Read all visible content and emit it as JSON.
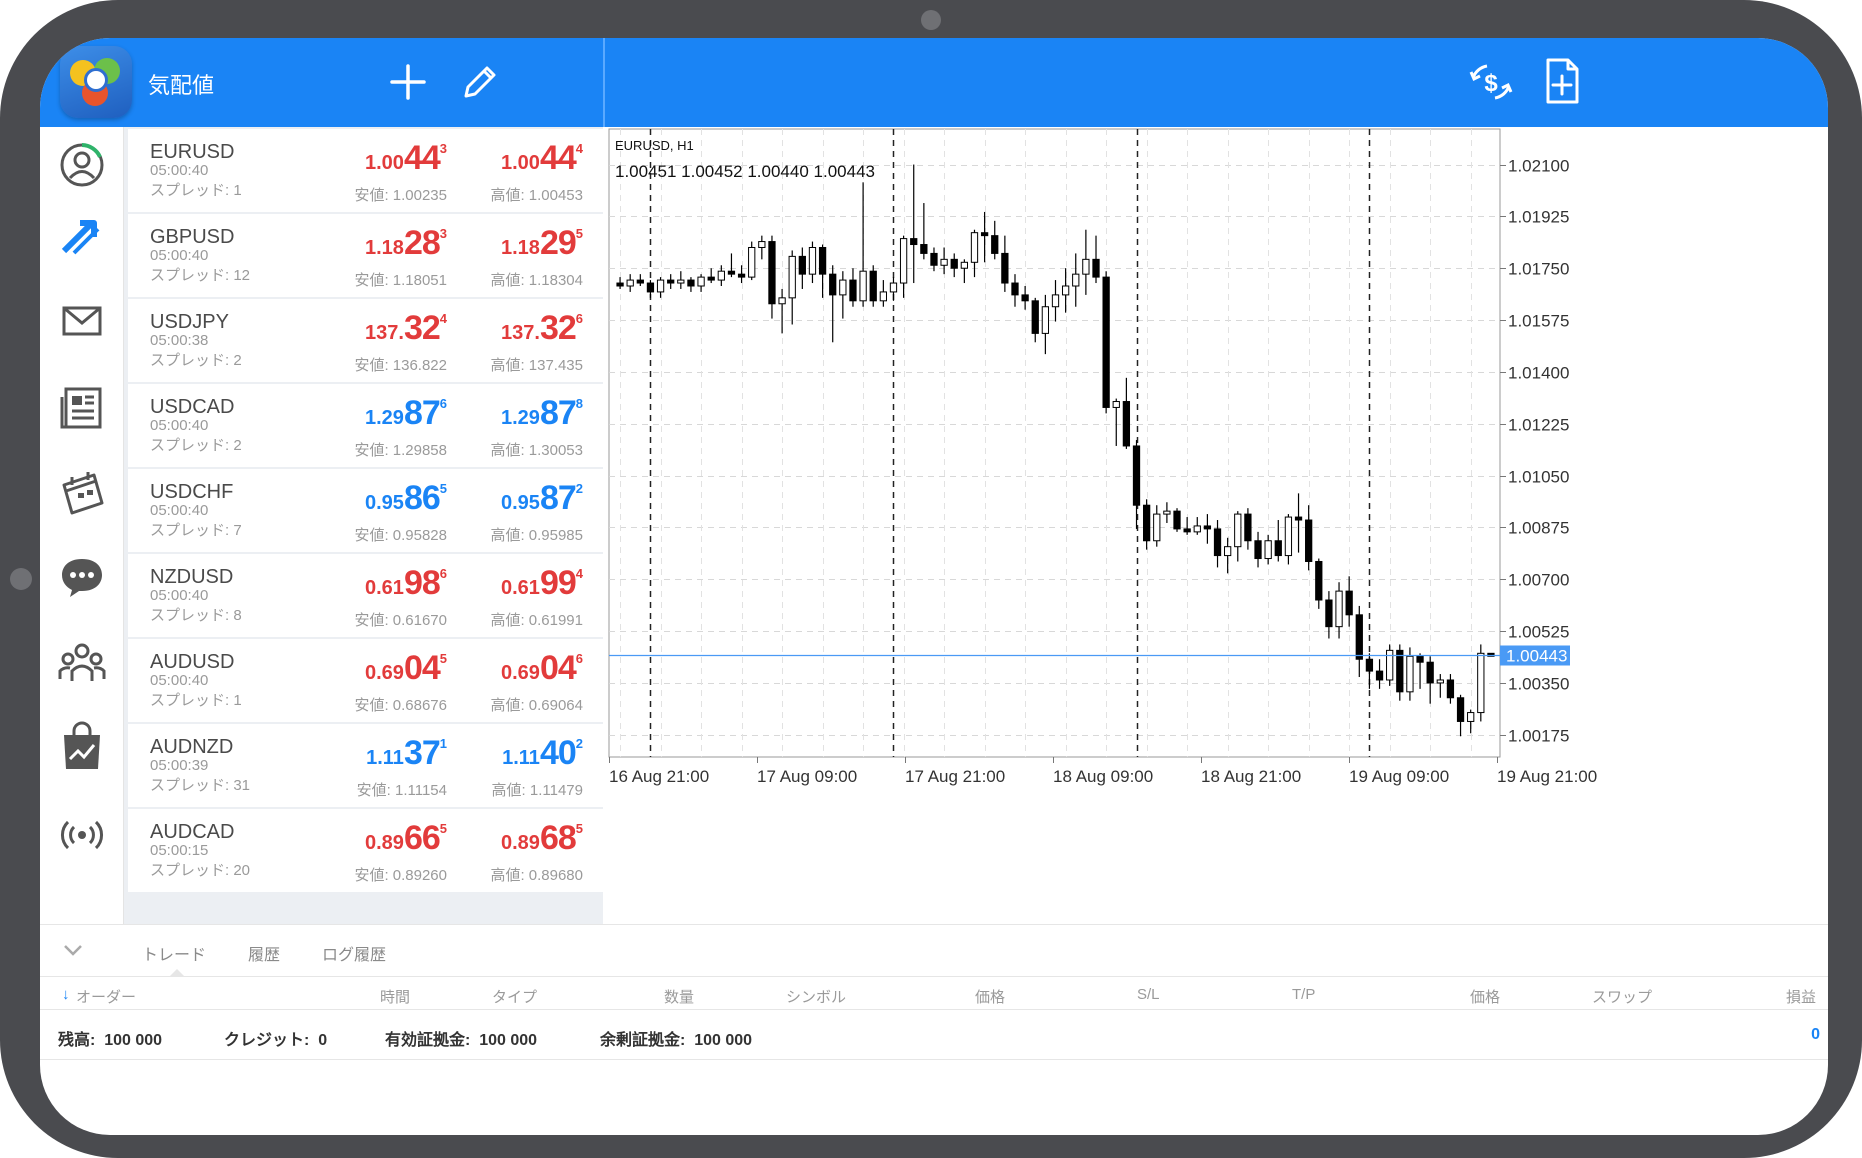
{
  "header": {
    "title": "気配値"
  },
  "quotes": [
    {
      "symbol": "EURUSD",
      "time": "05:00:40",
      "spread": "スプレッド: 1",
      "color": "red",
      "bid": {
        "a": "1.00",
        "b": "44",
        "c": "3"
      },
      "ask": {
        "a": "1.00",
        "b": "44",
        "c": "4"
      },
      "low": "安値: 1.00235",
      "high": "高値: 1.00453"
    },
    {
      "symbol": "GBPUSD",
      "time": "05:00:40",
      "spread": "スプレッド: 12",
      "color": "red",
      "bid": {
        "a": "1.18",
        "b": "28",
        "c": "3"
      },
      "ask": {
        "a": "1.18",
        "b": "29",
        "c": "5"
      },
      "low": "安値: 1.18051",
      "high": "高値: 1.18304"
    },
    {
      "symbol": "USDJPY",
      "time": "05:00:38",
      "spread": "スプレッド: 2",
      "color": "red",
      "bid": {
        "a": "137.",
        "b": "32",
        "c": "4"
      },
      "ask": {
        "a": "137.",
        "b": "32",
        "c": "6"
      },
      "low": "安値: 136.822",
      "high": "高値: 137.435"
    },
    {
      "symbol": "USDCAD",
      "time": "05:00:40",
      "spread": "スプレッド: 2",
      "color": "blue",
      "bid": {
        "a": "1.29",
        "b": "87",
        "c": "6"
      },
      "ask": {
        "a": "1.29",
        "b": "87",
        "c": "8"
      },
      "low": "安値: 1.29858",
      "high": "高値: 1.30053"
    },
    {
      "symbol": "USDCHF",
      "time": "05:00:40",
      "spread": "スプレッド: 7",
      "color": "blue",
      "bid": {
        "a": "0.95",
        "b": "86",
        "c": "5"
      },
      "ask": {
        "a": "0.95",
        "b": "87",
        "c": "2"
      },
      "low": "安値: 0.95828",
      "high": "高値: 0.95985"
    },
    {
      "symbol": "NZDUSD",
      "time": "05:00:40",
      "spread": "スプレッド: 8",
      "color": "red",
      "bid": {
        "a": "0.61",
        "b": "98",
        "c": "6"
      },
      "ask": {
        "a": "0.61",
        "b": "99",
        "c": "4"
      },
      "low": "安値: 0.61670",
      "high": "高値: 0.61991"
    },
    {
      "symbol": "AUDUSD",
      "time": "05:00:40",
      "spread": "スプレッド: 1",
      "color": "red",
      "bid": {
        "a": "0.69",
        "b": "04",
        "c": "5"
      },
      "ask": {
        "a": "0.69",
        "b": "04",
        "c": "6"
      },
      "low": "安値: 0.68676",
      "high": "高値: 0.69064"
    },
    {
      "symbol": "AUDNZD",
      "time": "05:00:39",
      "spread": "スプレッド: 31",
      "color": "blue",
      "bid": {
        "a": "1.11",
        "b": "37",
        "c": "1"
      },
      "ask": {
        "a": "1.11",
        "b": "40",
        "c": "2"
      },
      "low": "安値: 1.11154",
      "high": "高値: 1.11479"
    },
    {
      "symbol": "AUDCAD",
      "time": "05:00:15",
      "spread": "スプレッド: 20",
      "color": "red",
      "bid": {
        "a": "0.89",
        "b": "66",
        "c": "5"
      },
      "ask": {
        "a": "0.89",
        "b": "68",
        "c": "5"
      },
      "low": "安値: 0.89260",
      "high": "高値: 0.89680"
    }
  ],
  "chart": {
    "symbol_label": "EURUSD, H1",
    "ohlc_label": "1.00451 1.00452 1.00440 1.00443",
    "y_ticks": [
      "1.02100",
      "1.01925",
      "1.01750",
      "1.01575",
      "1.01400",
      "1.01225",
      "1.01050",
      "1.00875",
      "1.00700",
      "1.00525",
      "1.00350",
      "1.00175"
    ],
    "x_ticks": [
      "16 Aug 21:00",
      "17 Aug 09:00",
      "17 Aug 21:00",
      "18 Aug 09:00",
      "18 Aug 21:00",
      "19 Aug 09:00",
      "19 Aug 21:00"
    ],
    "current_price": "1.00443",
    "price_line_color": "#4a9af5"
  },
  "chart_data": {
    "type": "candlestick",
    "symbol": "EURUSD",
    "timeframe": "H1",
    "ylim": [
      1.001,
      1.0222
    ],
    "current_price": 1.00443,
    "candles": [
      [
        1.017,
        1.0172,
        1.0168,
        1.0169
      ],
      [
        1.0169,
        1.0173,
        1.0167,
        1.0171
      ],
      [
        1.0171,
        1.0173,
        1.0169,
        1.017
      ],
      [
        1.017,
        1.0171,
        1.0165,
        1.0167
      ],
      [
        1.0167,
        1.0172,
        1.0165,
        1.0171
      ],
      [
        1.0171,
        1.0173,
        1.0168,
        1.017
      ],
      [
        1.017,
        1.0174,
        1.0168,
        1.0171
      ],
      [
        1.0171,
        1.0172,
        1.0167,
        1.0169
      ],
      [
        1.0169,
        1.0173,
        1.0167,
        1.0172
      ],
      [
        1.0172,
        1.0175,
        1.017,
        1.0171
      ],
      [
        1.0171,
        1.0176,
        1.0169,
        1.0174
      ],
      [
        1.0174,
        1.018,
        1.0172,
        1.0173
      ],
      [
        1.0173,
        1.0176,
        1.017,
        1.0172
      ],
      [
        1.0172,
        1.0184,
        1.0171,
        1.0182
      ],
      [
        1.0182,
        1.0186,
        1.0178,
        1.0184
      ],
      [
        1.0184,
        1.0186,
        1.0158,
        1.0163
      ],
      [
        1.0163,
        1.0168,
        1.0153,
        1.0165
      ],
      [
        1.0165,
        1.0181,
        1.0156,
        1.0179
      ],
      [
        1.0179,
        1.0182,
        1.0168,
        1.0173
      ],
      [
        1.0173,
        1.0184,
        1.017,
        1.0182
      ],
      [
        1.0182,
        1.0183,
        1.0165,
        1.0173
      ],
      [
        1.0173,
        1.0176,
        1.015,
        1.0166
      ],
      [
        1.0166,
        1.0174,
        1.0158,
        1.0171
      ],
      [
        1.0171,
        1.0175,
        1.0162,
        1.0164
      ],
      [
        1.0164,
        1.0204,
        1.0162,
        1.0174
      ],
      [
        1.0174,
        1.0176,
        1.0162,
        1.0164
      ],
      [
        1.0164,
        1.0171,
        1.0162,
        1.0167
      ],
      [
        1.0167,
        1.0172,
        1.0164,
        1.017
      ],
      [
        1.017,
        1.0186,
        1.0165,
        1.0185
      ],
      [
        1.0185,
        1.021,
        1.017,
        1.0183
      ],
      [
        1.0183,
        1.0197,
        1.0178,
        1.018
      ],
      [
        1.018,
        1.0182,
        1.0174,
        1.0176
      ],
      [
        1.0176,
        1.0182,
        1.0173,
        1.0178
      ],
      [
        1.0178,
        1.018,
        1.0172,
        1.0175
      ],
      [
        1.0175,
        1.0178,
        1.017,
        1.0177
      ],
      [
        1.0177,
        1.0188,
        1.0172,
        1.0187
      ],
      [
        1.0187,
        1.0194,
        1.0177,
        1.0186
      ],
      [
        1.0186,
        1.0191,
        1.0178,
        1.018
      ],
      [
        1.018,
        1.0186,
        1.0167,
        1.017
      ],
      [
        1.017,
        1.0173,
        1.0162,
        1.0166
      ],
      [
        1.0166,
        1.0169,
        1.0161,
        1.0164
      ],
      [
        1.0164,
        1.0165,
        1.015,
        1.0153
      ],
      [
        1.0153,
        1.0166,
        1.0146,
        1.0162
      ],
      [
        1.0162,
        1.0171,
        1.0157,
        1.0166
      ],
      [
        1.0166,
        1.0175,
        1.016,
        1.0169
      ],
      [
        1.0169,
        1.018,
        1.0162,
        1.0173
      ],
      [
        1.0173,
        1.0188,
        1.0166,
        1.0178
      ],
      [
        1.0178,
        1.0186,
        1.017,
        1.0172
      ],
      [
        1.0172,
        1.0174,
        1.0126,
        1.0128
      ],
      [
        1.0128,
        1.0131,
        1.0115,
        1.013
      ],
      [
        1.013,
        1.0138,
        1.0114,
        1.0115
      ],
      [
        1.0115,
        1.0117,
        1.0087,
        1.0095
      ],
      [
        1.0095,
        1.0097,
        1.008,
        1.0083
      ],
      [
        1.0083,
        1.0095,
        1.0081,
        1.0092
      ],
      [
        1.0092,
        1.0096,
        1.0089,
        1.0093
      ],
      [
        1.0093,
        1.0094,
        1.0086,
        1.0087
      ],
      [
        1.0087,
        1.0091,
        1.0085,
        1.0086
      ],
      [
        1.0086,
        1.0091,
        1.0085,
        1.0088
      ],
      [
        1.0088,
        1.0092,
        1.0082,
        1.0087
      ],
      [
        1.0087,
        1.009,
        1.0074,
        1.0078
      ],
      [
        1.0078,
        1.0084,
        1.0072,
        1.0081
      ],
      [
        1.0081,
        1.0093,
        1.0076,
        1.0092
      ],
      [
        1.0092,
        1.0094,
        1.008,
        1.0083
      ],
      [
        1.0083,
        1.0086,
        1.0074,
        1.0077
      ],
      [
        1.0077,
        1.0085,
        1.0075,
        1.0083
      ],
      [
        1.0083,
        1.009,
        1.0076,
        1.0078
      ],
      [
        1.0078,
        1.0092,
        1.0075,
        1.0091
      ],
      [
        1.0091,
        1.0099,
        1.0079,
        1.009
      ],
      [
        1.009,
        1.0095,
        1.0073,
        1.0076
      ],
      [
        1.0076,
        1.0077,
        1.006,
        1.0063
      ],
      [
        1.0063,
        1.0066,
        1.005,
        1.0054
      ],
      [
        1.0054,
        1.0069,
        1.005,
        1.0066
      ],
      [
        1.0066,
        1.0071,
        1.0054,
        1.0058
      ],
      [
        1.0058,
        1.0061,
        1.0037,
        1.0043
      ],
      [
        1.0043,
        1.0045,
        1.0033,
        1.0039
      ],
      [
        1.0039,
        1.0043,
        1.0033,
        1.0036
      ],
      [
        1.0036,
        1.0048,
        1.0034,
        1.0046
      ],
      [
        1.0046,
        1.0048,
        1.0029,
        1.0032
      ],
      [
        1.0032,
        1.0047,
        1.0029,
        1.0044
      ],
      [
        1.0044,
        1.0045,
        1.0033,
        1.0042
      ],
      [
        1.0042,
        1.0044,
        1.0028,
        1.0035
      ],
      [
        1.0035,
        1.0038,
        1.003,
        1.0036
      ],
      [
        1.0036,
        1.0038,
        1.0028,
        1.003
      ],
      [
        1.003,
        1.0031,
        1.0017,
        1.0022
      ],
      [
        1.0022,
        1.0026,
        1.0018,
        1.0025
      ],
      [
        1.0025,
        1.0048,
        1.0022,
        1.0045
      ],
      [
        1.0045,
        1.0045,
        1.0044,
        1.0044
      ]
    ]
  },
  "bottom": {
    "tabs": [
      "トレード",
      "履歴",
      "ログ履歴"
    ],
    "columns": [
      "オーダー",
      "時間",
      "タイプ",
      "数量",
      "シンボル",
      "価格",
      "S/L",
      "T/P",
      "価格",
      "スワップ",
      "損益"
    ],
    "balance": [
      {
        "label": "残高:",
        "value": "100 000"
      },
      {
        "label": "クレジット:",
        "value": "0"
      },
      {
        "label": "有効証拠金:",
        "value": "100 000"
      },
      {
        "label": "余剰証拠金:",
        "value": "100 000"
      }
    ],
    "pnl": "0"
  }
}
